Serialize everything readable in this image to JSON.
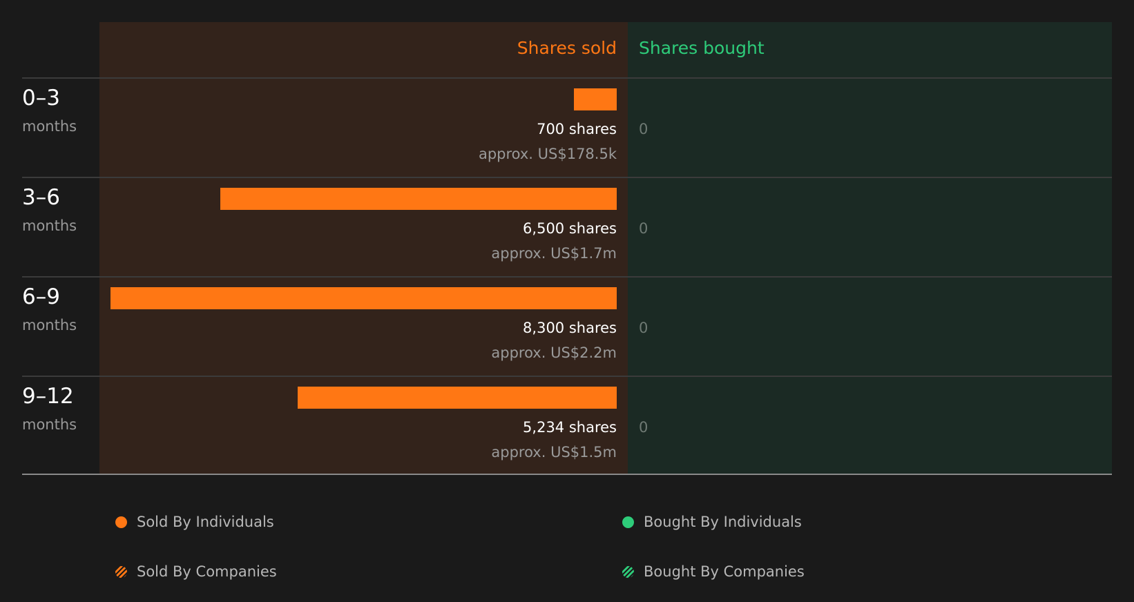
{
  "columns": {
    "sold": "Shares sold",
    "bought": "Shares bought"
  },
  "colors": {
    "sold": "#ff7714",
    "bought": "#2ecc7a",
    "sold_panel": "#33231b",
    "bought_panel": "#1b2a24"
  },
  "chart_data": {
    "type": "bar",
    "orientation": "horizontal",
    "categories": [
      "0–3 months",
      "3–6 months",
      "6–9 months",
      "9–12 months"
    ],
    "series": [
      {
        "name": "Sold By Individuals",
        "values": [
          700,
          6500,
          8300,
          5234
        ]
      },
      {
        "name": "Bought By Individuals",
        "values": [
          0,
          0,
          0,
          0
        ]
      }
    ],
    "rows": [
      {
        "range": "0–3",
        "unit": "months",
        "sold": 700,
        "sold_label": "700 shares",
        "approx": "approx. US$178.5k",
        "bought_label": "0"
      },
      {
        "range": "3–6",
        "unit": "months",
        "sold": 6500,
        "sold_label": "6,500 shares",
        "approx": "approx. US$1.7m",
        "bought_label": "0"
      },
      {
        "range": "6–9",
        "unit": "months",
        "sold": 8300,
        "sold_label": "8,300 shares",
        "approx": "approx. US$2.2m",
        "bought_label": "0"
      },
      {
        "range": "9–12",
        "unit": "months",
        "sold": 5234,
        "sold_label": "5,234 shares",
        "approx": "approx. US$1.5m",
        "bought_label": "0"
      }
    ],
    "legend": [
      {
        "label": "Sold By Individuals",
        "color": "#ff7714",
        "pattern": "solid"
      },
      {
        "label": "Bought By Individuals",
        "color": "#2ecc7a",
        "pattern": "solid"
      },
      {
        "label": "Sold By Companies",
        "color": "#ff7714",
        "pattern": "striped"
      },
      {
        "label": "Bought By Companies",
        "color": "#2ecc7a",
        "pattern": "striped"
      }
    ],
    "legend_position": "bottom"
  }
}
